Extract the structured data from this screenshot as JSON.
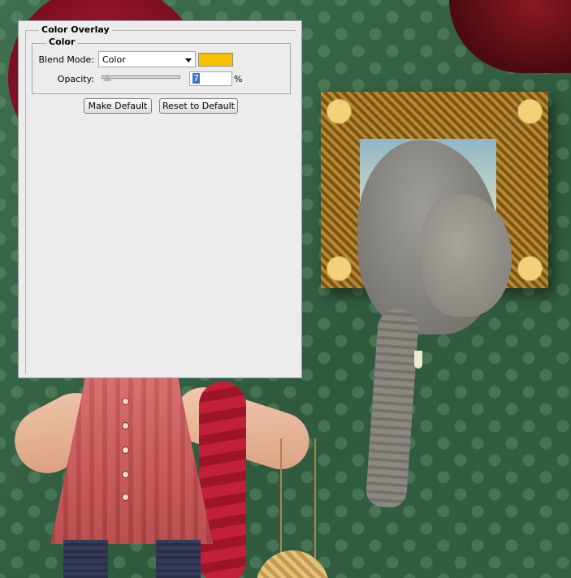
{
  "dialog": {
    "section_title": "Color Overlay",
    "group_title": "Color",
    "blend_mode_label": "Blend Mode:",
    "blend_mode_value": "Color",
    "overlay_color": "#f7c102",
    "opacity_label": "Opacity:",
    "opacity_value": "7",
    "opacity_unit": "%",
    "opacity_slider_fraction": 0.07,
    "make_default_label": "Make Default",
    "reset_default_label": "Reset to Default"
  }
}
